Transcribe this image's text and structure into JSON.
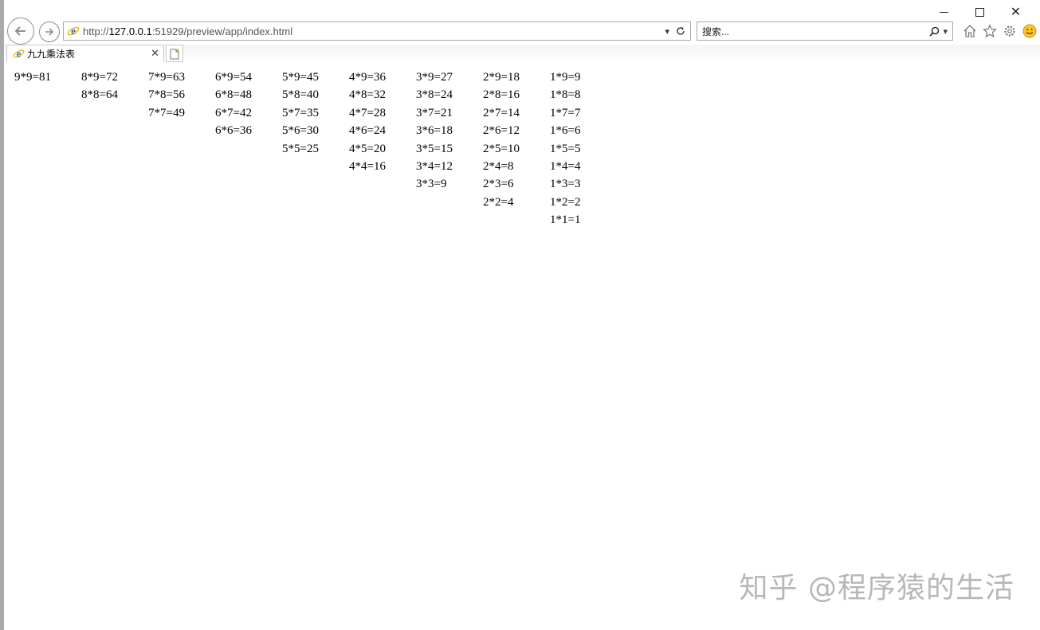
{
  "browser": {
    "url_prefix": "http://",
    "url_host": "127.0.0.1",
    "url_rest": ":51929/preview/app/index.html",
    "search_placeholder": "搜索...",
    "tab_title": "九九乘法表"
  },
  "table": {
    "columns": [
      [
        "9*9=81"
      ],
      [
        "8*9=72",
        "8*8=64"
      ],
      [
        "7*9=63",
        "7*8=56",
        "7*7=49"
      ],
      [
        "6*9=54",
        "6*8=48",
        "6*7=42",
        "6*6=36"
      ],
      [
        "5*9=45",
        "5*8=40",
        "5*7=35",
        "5*6=30",
        "5*5=25"
      ],
      [
        "4*9=36",
        "4*8=32",
        "4*7=28",
        "4*6=24",
        "4*5=20",
        "4*4=16"
      ],
      [
        "3*9=27",
        "3*8=24",
        "3*7=21",
        "3*6=18",
        "3*5=15",
        "3*4=12",
        "3*3=9"
      ],
      [
        "2*9=18",
        "2*8=16",
        "2*7=14",
        "2*6=12",
        "2*5=10",
        "2*4=8",
        "2*3=6",
        "2*2=4"
      ],
      [
        "1*9=9",
        "1*8=8",
        "1*7=7",
        "1*6=6",
        "1*5=5",
        "1*4=4",
        "1*3=3",
        "1*2=2",
        "1*1=1"
      ]
    ]
  },
  "watermark": "知乎 @程序猿的生活",
  "colors": {
    "ie_blue": "#1d6fc4",
    "ie_ring": "#f2b705",
    "border": "#aaaaaa"
  }
}
